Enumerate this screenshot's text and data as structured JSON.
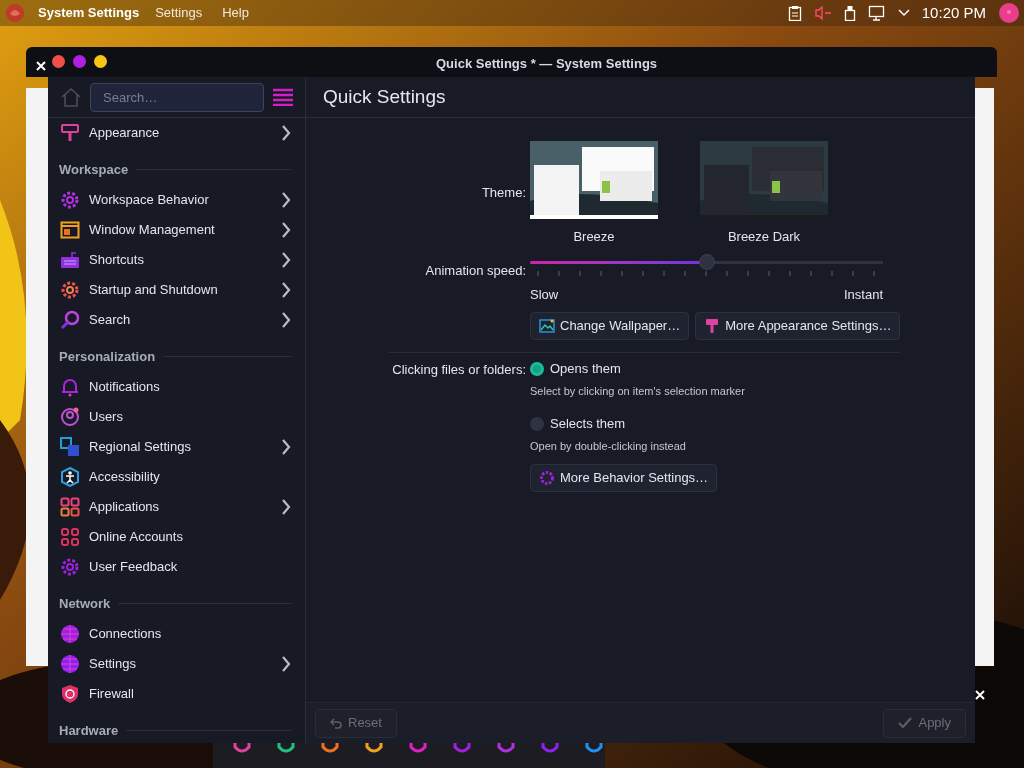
{
  "top_panel": {
    "app_menu": "System Settings",
    "menus": [
      "Settings",
      "Help"
    ],
    "clock": "10:20 PM"
  },
  "window": {
    "title": "Quick Settings * — System Settings"
  },
  "sidebar": {
    "search": {
      "placeholder": "Search…"
    },
    "sections": [
      {
        "items": [
          {
            "label": "Appearance",
            "has_children": true
          }
        ]
      },
      {
        "title": "Workspace",
        "items": [
          {
            "label": "Workspace Behavior",
            "has_children": true
          },
          {
            "label": "Window Management",
            "has_children": true
          },
          {
            "label": "Shortcuts",
            "has_children": true
          },
          {
            "label": "Startup and Shutdown",
            "has_children": true
          },
          {
            "label": "Search",
            "has_children": true
          }
        ]
      },
      {
        "title": "Personalization",
        "items": [
          {
            "label": "Notifications",
            "has_children": false
          },
          {
            "label": "Users",
            "has_children": false
          },
          {
            "label": "Regional Settings",
            "has_children": true
          },
          {
            "label": "Accessibility",
            "has_children": false
          },
          {
            "label": "Applications",
            "has_children": true
          },
          {
            "label": "Online Accounts",
            "has_children": false
          },
          {
            "label": "User Feedback",
            "has_children": false
          }
        ]
      },
      {
        "title": "Network",
        "items": [
          {
            "label": "Connections",
            "has_children": false
          },
          {
            "label": "Settings",
            "has_children": true
          },
          {
            "label": "Firewall",
            "has_children": false
          }
        ]
      },
      {
        "title": "Hardware"
      }
    ]
  },
  "page": {
    "title": "Quick Settings",
    "theme": {
      "label": "Theme:",
      "options": [
        {
          "name": "Breeze",
          "kind": "light"
        },
        {
          "name": "Breeze Dark",
          "kind": "dark"
        }
      ]
    },
    "animation": {
      "label": "Animation speed:",
      "level": 0.5,
      "min_label": "Slow",
      "max_label": "Instant"
    },
    "appearance_buttons": [
      {
        "label": "Change Wallpaper…",
        "kind": "wallpaper"
      },
      {
        "label": "More Appearance Settings…",
        "kind": "appearance"
      }
    ],
    "clicking": {
      "label": "Clicking files or folders:",
      "options": [
        {
          "label": "Opens them",
          "description": "Select by clicking on item's selection marker",
          "selected": true
        },
        {
          "label": "Selects them",
          "description": "Open by double-clicking instead",
          "selected": false
        }
      ]
    },
    "behavior_button": "More Behavior Settings…"
  },
  "footer": {
    "buttons": [
      {
        "label": "Reset",
        "kind": "reset",
        "disabled": true
      },
      {
        "label": "Apply",
        "kind": "apply",
        "disabled": true
      }
    ]
  }
}
